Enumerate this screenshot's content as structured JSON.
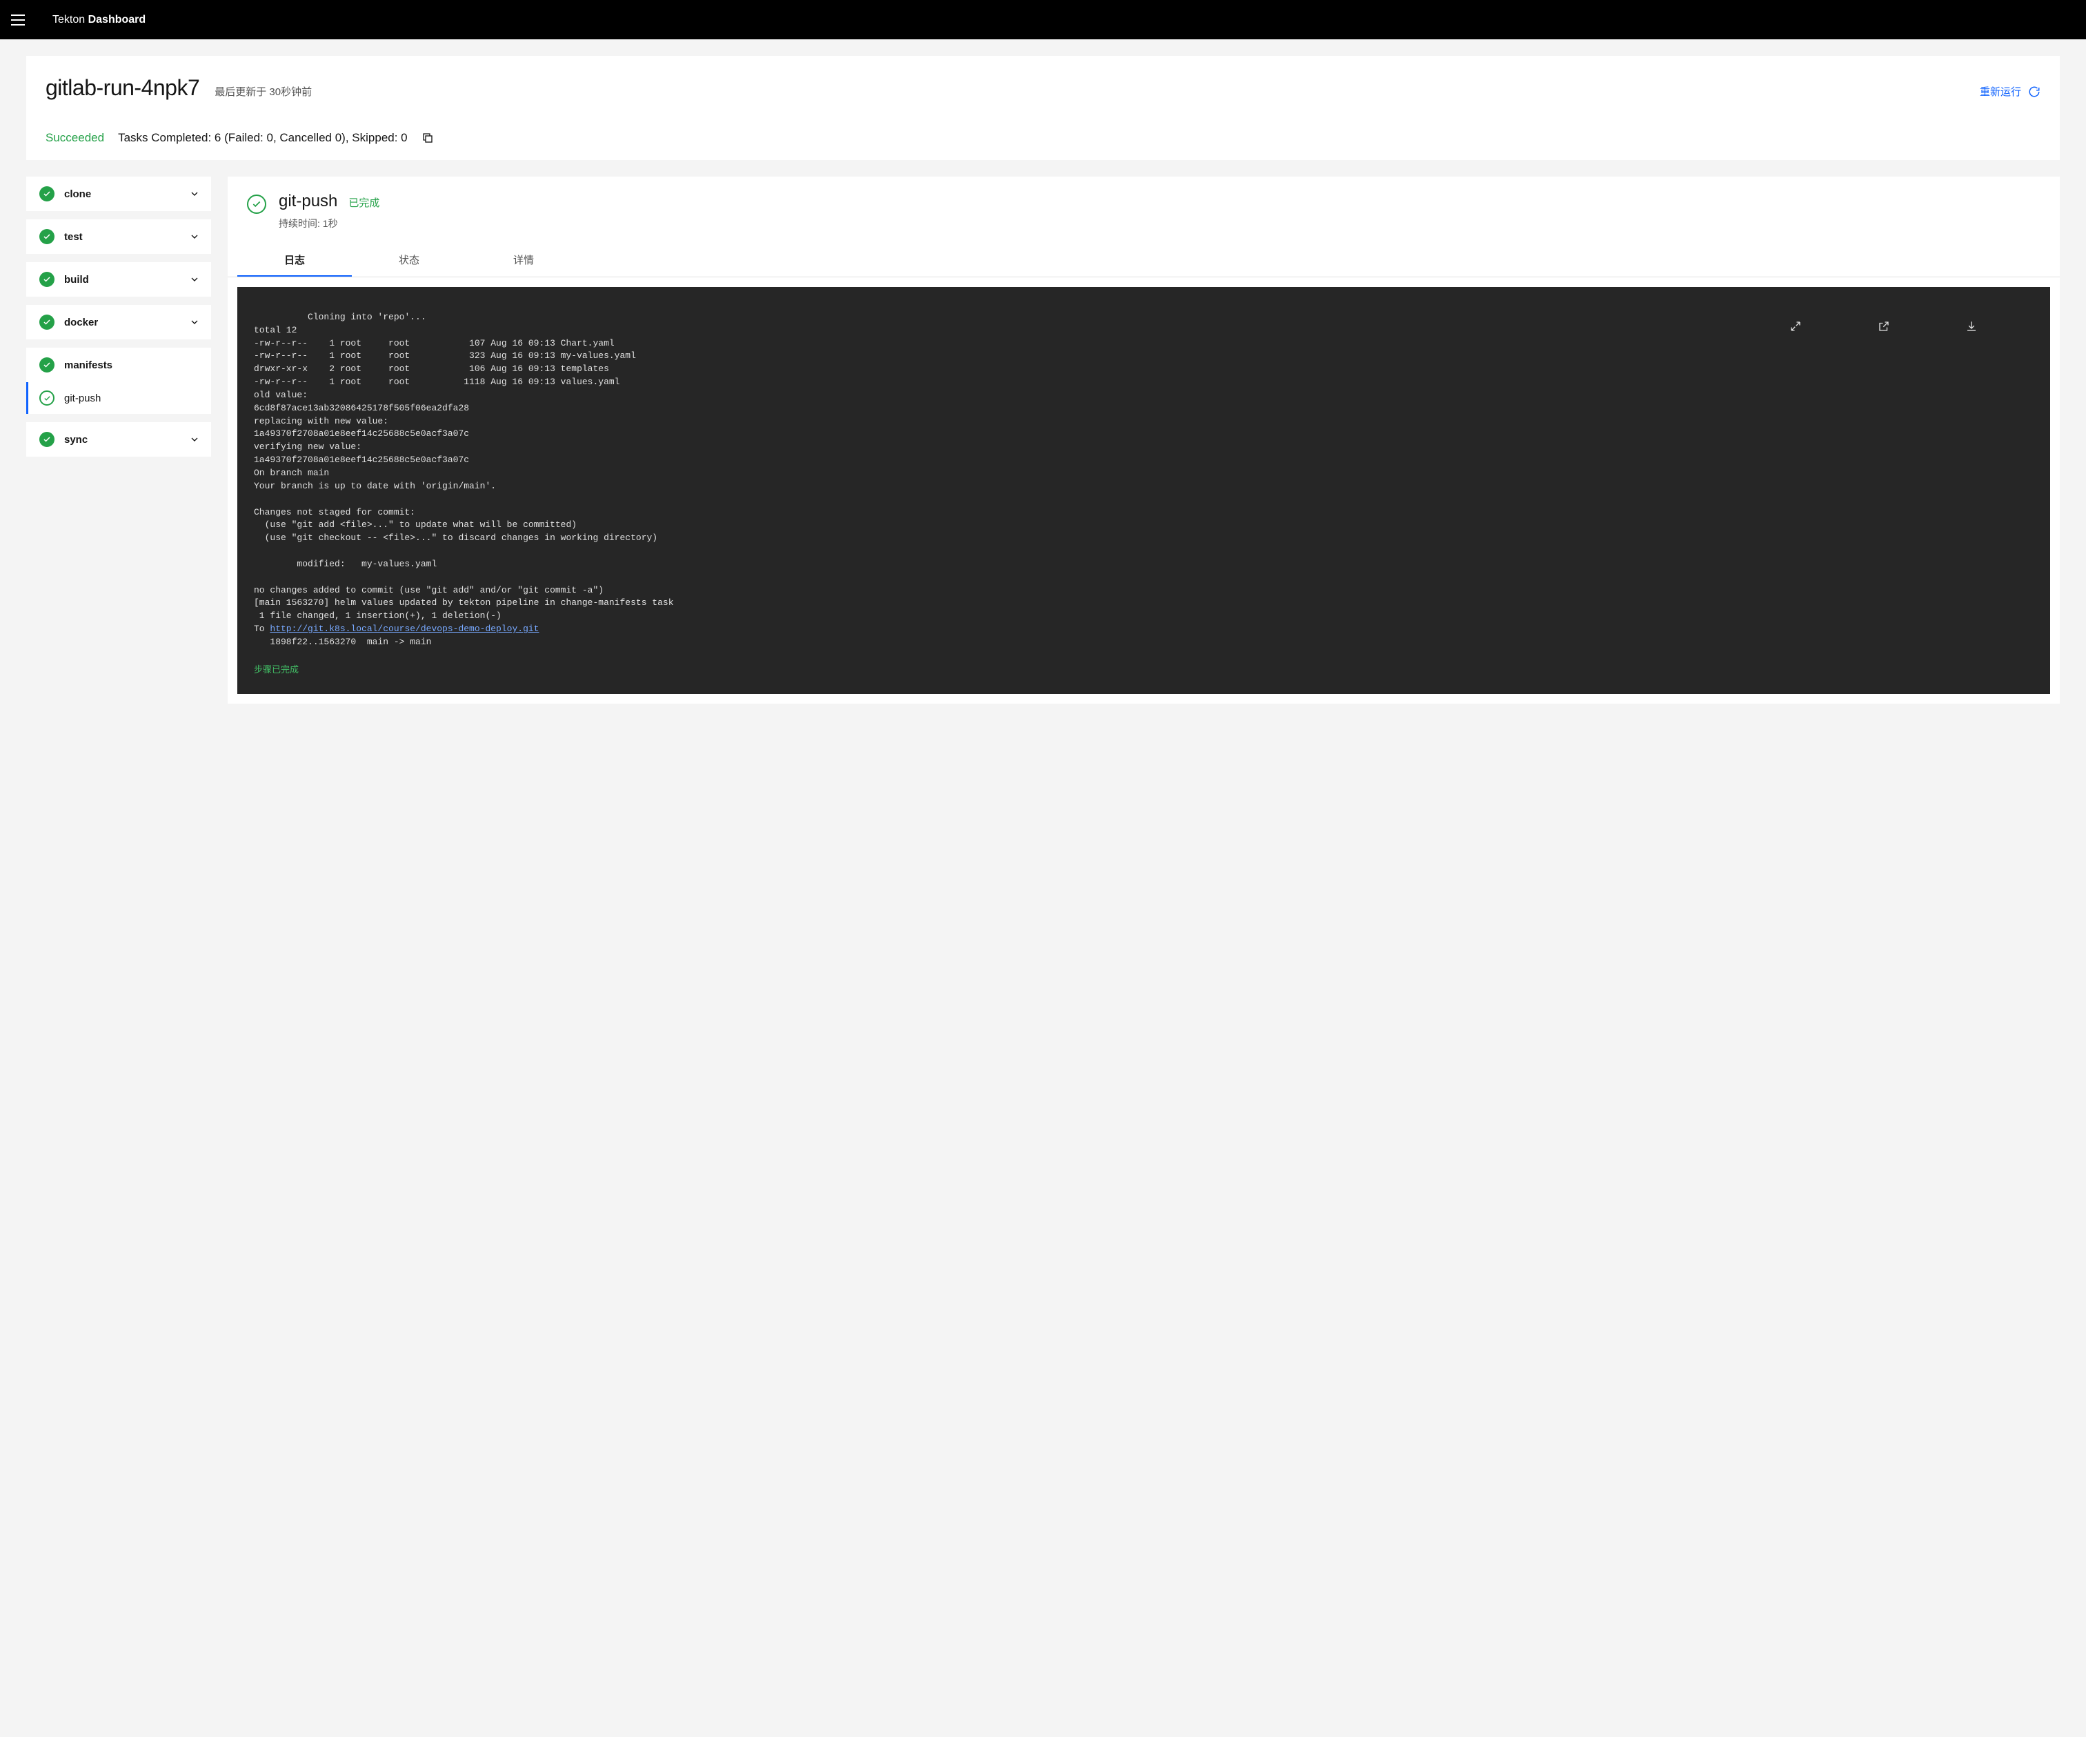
{
  "brand": {
    "light": "Tekton ",
    "bold": "Dashboard"
  },
  "header": {
    "title": "gitlab-run-4npk7",
    "updated": "最后更新于 30秒钟前",
    "rerun": "重新运行",
    "status_label": "Succeeded",
    "status_detail": "Tasks Completed: 6 (Failed: 0, Cancelled 0), Skipped: 0"
  },
  "sidebar": {
    "tasks": [
      {
        "name": "clone"
      },
      {
        "name": "test"
      },
      {
        "name": "build"
      },
      {
        "name": "docker"
      },
      {
        "name": "manifests",
        "expanded": true,
        "steps": [
          {
            "name": "git-push",
            "selected": true
          }
        ]
      },
      {
        "name": "sync"
      }
    ]
  },
  "step": {
    "title": "git-push",
    "status": "已完成",
    "duration": "持续时间: 1秒",
    "tabs": {
      "log": "日志",
      "status": "状态",
      "details": "详情"
    }
  },
  "log": {
    "footer": "步骤已完成",
    "link_text": "http://git.k8s.local/course/devops-demo-deploy.git",
    "pre": "Cloning into 'repo'...\ntotal 12\n-rw-r--r--    1 root     root           107 Aug 16 09:13 Chart.yaml\n-rw-r--r--    1 root     root           323 Aug 16 09:13 my-values.yaml\ndrwxr-xr-x    2 root     root           106 Aug 16 09:13 templates\n-rw-r--r--    1 root     root          1118 Aug 16 09:13 values.yaml\nold value:\n6cd8f87ace13ab32086425178f505f06ea2dfa28\nreplacing with new value:\n1a49370f2708a01e8eef14c25688c5e0acf3a07c\nverifying new value:\n1a49370f2708a01e8eef14c25688c5e0acf3a07c\nOn branch main\nYour branch is up to date with 'origin/main'.\n\nChanges not staged for commit:\n  (use \"git add <file>...\" to update what will be committed)\n  (use \"git checkout -- <file>...\" to discard changes in working directory)\n\n        modified:   my-values.yaml\n\nno changes added to commit (use \"git add\" and/or \"git commit -a\")\n[main 1563270] helm values updated by tekton pipeline in change-manifests task\n 1 file changed, 1 insertion(+), 1 deletion(-)\nTo ",
    "post": "\n   1898f22..1563270  main -> main"
  }
}
